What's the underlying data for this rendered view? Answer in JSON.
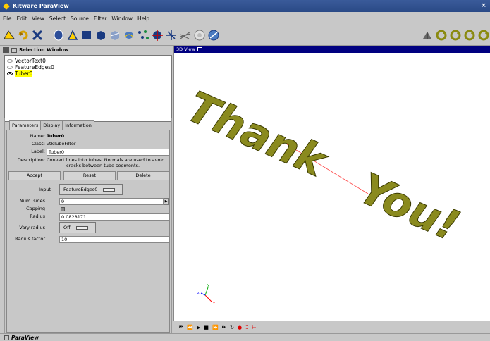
{
  "window": {
    "title": "Kitware ParaView",
    "min_btn": "_",
    "close_btn": "×"
  },
  "menu": [
    "File",
    "Edit",
    "View",
    "Select",
    "Source",
    "Filter",
    "Window",
    "Help"
  ],
  "toolbar": {
    "icons": [
      "open-icon",
      "refresh-icon",
      "delete-icon",
      "sphere-icon",
      "tube-icon",
      "contour-icon",
      "cube-icon",
      "clip-icon",
      "streamline-icon",
      "points-icon",
      "crosshair-icon",
      "axes-icon",
      "glyph-icon",
      "sphere2-icon",
      "disk-icon"
    ],
    "right_icons": [
      "reset-camera-icon",
      "rotate-x-icon",
      "rotate-y-icon",
      "rotate-z-icon",
      "rotate-all-icon"
    ]
  },
  "selection_window": {
    "title": "Selection Window",
    "items": [
      {
        "label": "VectorText0",
        "visible": false,
        "selected": false
      },
      {
        "label": "FeatureEdges0",
        "visible": false,
        "selected": false
      },
      {
        "label": "Tuber0",
        "visible": true,
        "selected": true
      }
    ]
  },
  "tabs": [
    "Parameters",
    "Display",
    "Information"
  ],
  "parameters": {
    "name_label": "Name:",
    "name_value": "Tuber0",
    "class_label": "Class:",
    "class_value": "vtkTubeFilter",
    "label_label": "Label:",
    "label_value": "Tuber0",
    "desc_label": "Description:",
    "desc_line1": "Convert lines into tubes.  Normals are used to avoid",
    "desc_line2": "cracks between tube segments.",
    "accept": "Accept",
    "reset": "Reset",
    "delete": "Delete",
    "input_label": "Input",
    "input_value": "FeatureEdges0",
    "num_sides_label": "Num. sides",
    "num_sides_value": "9",
    "capping_label": "Capping",
    "radius_label": "Radius",
    "radius_value": "0.0828171",
    "vary_radius_label": "Vary radius",
    "vary_radius_value": "Off",
    "radius_factor_label": "Radius factor",
    "radius_factor_value": "10"
  },
  "view": {
    "title": "3D View",
    "text_line1": "Thank",
    "text_line2": "You!",
    "text_color": "#8a8a1e",
    "axes": {
      "x": "x",
      "y": "y",
      "z": "z"
    }
  },
  "animation": {
    "controls": [
      "first-frame-icon",
      "prev-frame-icon",
      "play-icon",
      "stop-icon",
      "next-frame-icon",
      "last-frame-icon",
      "loop-icon",
      "record-icon",
      "camera-icon",
      "keyframe-icon"
    ]
  },
  "status": {
    "app_name": "ParaView"
  }
}
